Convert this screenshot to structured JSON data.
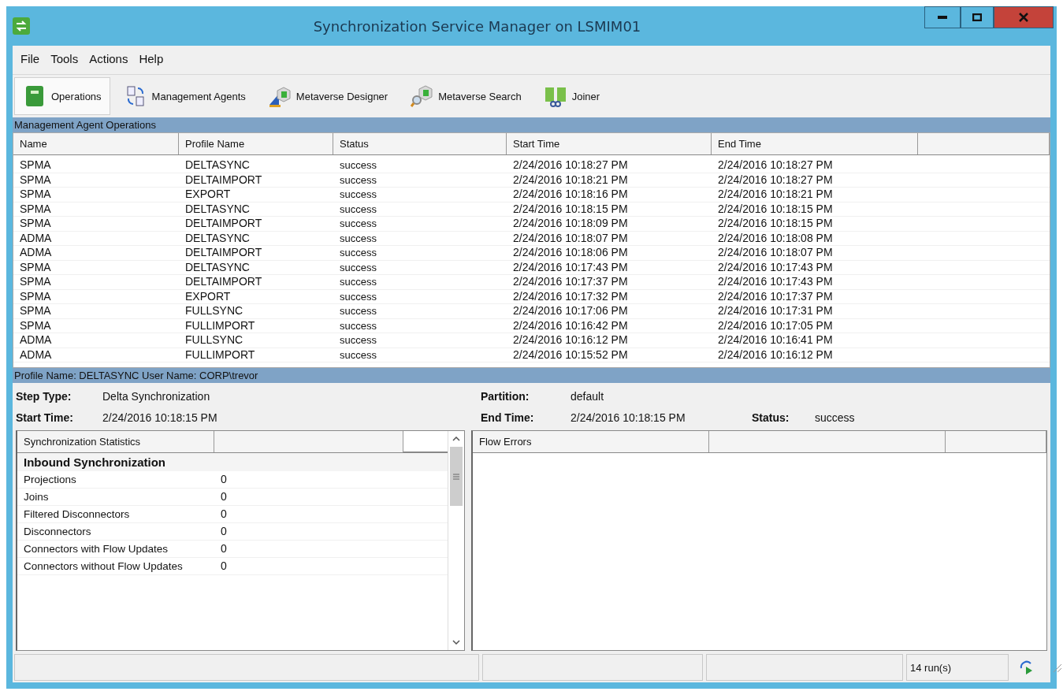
{
  "window": {
    "title": "Synchronization Service Manager on LSMIM01"
  },
  "menu": [
    "File",
    "Tools",
    "Actions",
    "Help"
  ],
  "toolbar": [
    {
      "label": "Operations",
      "selected": true
    },
    {
      "label": "Management Agents",
      "selected": false
    },
    {
      "label": "Metaverse Designer",
      "selected": false
    },
    {
      "label": "Metaverse Search",
      "selected": false
    },
    {
      "label": "Joiner",
      "selected": false
    }
  ],
  "operations": {
    "title": "Management Agent Operations",
    "columns": [
      "Name",
      "Profile Name",
      "Status",
      "Start Time",
      "End Time"
    ],
    "rows": [
      [
        "SPMA",
        "DELTASYNC",
        "success",
        "2/24/2016 10:18:27 PM",
        "2/24/2016 10:18:27 PM"
      ],
      [
        "SPMA",
        "DELTAIMPORT",
        "success",
        "2/24/2016 10:18:21 PM",
        "2/24/2016 10:18:27 PM"
      ],
      [
        "SPMA",
        "EXPORT",
        "success",
        "2/24/2016 10:18:16 PM",
        "2/24/2016 10:18:21 PM"
      ],
      [
        "SPMA",
        "DELTASYNC",
        "success",
        "2/24/2016 10:18:15 PM",
        "2/24/2016 10:18:15 PM"
      ],
      [
        "SPMA",
        "DELTAIMPORT",
        "success",
        "2/24/2016 10:18:09 PM",
        "2/24/2016 10:18:15 PM"
      ],
      [
        "ADMA",
        "DELTASYNC",
        "success",
        "2/24/2016 10:18:07 PM",
        "2/24/2016 10:18:08 PM"
      ],
      [
        "ADMA",
        "DELTAIMPORT",
        "success",
        "2/24/2016 10:18:06 PM",
        "2/24/2016 10:18:07 PM"
      ],
      [
        "SPMA",
        "DELTASYNC",
        "success",
        "2/24/2016 10:17:43 PM",
        "2/24/2016 10:17:43 PM"
      ],
      [
        "SPMA",
        "DELTAIMPORT",
        "success",
        "2/24/2016 10:17:37 PM",
        "2/24/2016 10:17:43 PM"
      ],
      [
        "SPMA",
        "EXPORT",
        "success",
        "2/24/2016 10:17:32 PM",
        "2/24/2016 10:17:37 PM"
      ],
      [
        "SPMA",
        "FULLSYNC",
        "success",
        "2/24/2016 10:17:06 PM",
        "2/24/2016 10:17:31 PM"
      ],
      [
        "SPMA",
        "FULLIMPORT",
        "success",
        "2/24/2016 10:16:42 PM",
        "2/24/2016 10:17:05 PM"
      ],
      [
        "ADMA",
        "FULLSYNC",
        "success",
        "2/24/2016 10:16:12 PM",
        "2/24/2016 10:16:41 PM"
      ],
      [
        "ADMA",
        "FULLIMPORT",
        "success",
        "2/24/2016 10:15:52 PM",
        "2/24/2016 10:16:12 PM"
      ]
    ]
  },
  "details": {
    "header": "Profile Name: DELTASYNC  User Name: CORP\\trevor",
    "step_type": {
      "label": "Step Type:",
      "value": "Delta Synchronization"
    },
    "start_time": {
      "label": "Start Time:",
      "value": "2/24/2016 10:18:15 PM"
    },
    "partition": {
      "label": "Partition:",
      "value": "default"
    },
    "end_time": {
      "label": "End Time:",
      "value": "2/24/2016 10:18:15 PM"
    },
    "status": {
      "label": "Status:",
      "value": "success"
    }
  },
  "statistics": {
    "column": "Synchronization Statistics",
    "group": "Inbound Synchronization",
    "rows": [
      {
        "name": "Projections",
        "value": "0"
      },
      {
        "name": "Joins",
        "value": "0"
      },
      {
        "name": "Filtered Disconnectors",
        "value": "0"
      },
      {
        "name": "Disconnectors",
        "value": "0"
      },
      {
        "name": "Connectors with Flow Updates",
        "value": "0"
      },
      {
        "name": "Connectors without Flow Updates",
        "value": "0"
      }
    ]
  },
  "flow_errors": {
    "column": "Flow Errors"
  },
  "status_bar": {
    "runs": "14 run(s)"
  }
}
